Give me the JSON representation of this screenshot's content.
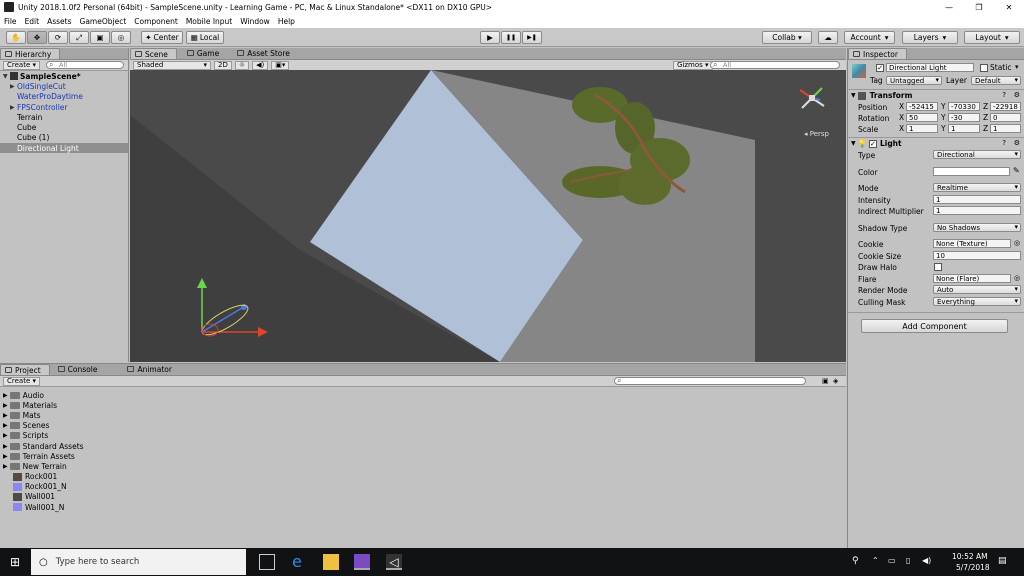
{
  "window": {
    "title": "Unity 2018.1.0f2 Personal (64bit) - SampleScene.unity - Learning Game - PC, Mac & Linux Standalone* <DX11 on DX10 GPU>",
    "min": "—",
    "max": "❐",
    "close": "✕"
  },
  "menu": [
    "File",
    "Edit",
    "Assets",
    "GameObject",
    "Component",
    "Mobile Input",
    "Window",
    "Help"
  ],
  "toolbar": {
    "center": "Center",
    "local": "Local",
    "collab": "Collab ▾",
    "account": "Account",
    "layers": "Layers",
    "layout": "Layout",
    "play": "▶",
    "pause": "❚❚",
    "step": "▶❚"
  },
  "hierarchy": {
    "tab": "Hierarchy",
    "create": "Create",
    "search_placeholder": "All",
    "scene": "SampleScene*",
    "items": [
      {
        "label": "OldSingleCut",
        "blue": true,
        "arrow": "▶"
      },
      {
        "label": "WaterProDaytime",
        "blue": true,
        "arrow": ""
      },
      {
        "label": "FPSController",
        "blue": true,
        "arrow": "▶"
      },
      {
        "label": "Terrain",
        "blue": false,
        "arrow": ""
      },
      {
        "label": "Cube",
        "blue": false,
        "arrow": ""
      },
      {
        "label": "Cube (1)",
        "blue": false,
        "arrow": ""
      },
      {
        "label": "Directional Light",
        "blue": false,
        "arrow": "",
        "selected": true
      }
    ]
  },
  "scene": {
    "tabs": [
      "Scene",
      "Game",
      "Asset Store"
    ],
    "shading": "Shaded",
    "mode2d": "2D",
    "gizmos": "Gizmos",
    "search_placeholder": "All",
    "persp": "◂ Persp"
  },
  "project": {
    "tabs": [
      "Project",
      "Console",
      "Animator"
    ],
    "create": "Create",
    "folders": [
      "Audio",
      "Materials",
      "Mats",
      "Scenes",
      "Scripts",
      "Standard Assets",
      "Terrain Assets",
      "New Terrain"
    ],
    "assets": [
      {
        "label": "Rock001",
        "color": "#5a4a3a"
      },
      {
        "label": "Rock001_N",
        "color": "#8a86f2"
      },
      {
        "label": "Wall001",
        "color": "#4e4a46"
      },
      {
        "label": "Wall001_N",
        "color": "#8a86f2"
      }
    ]
  },
  "inspector": {
    "tab": "Inspector",
    "object_name": "Directional Light",
    "static": "Static",
    "tag_label": "Tag",
    "tag_value": "Untagged",
    "layer_label": "Layer",
    "layer_value": "Default",
    "transform": {
      "title": "Transform",
      "position": {
        "label": "Position",
        "x": "-52415",
        "y": "-70330",
        "z": "-22918"
      },
      "rotation": {
        "label": "Rotation",
        "x": "50",
        "y": "-30",
        "z": "0"
      },
      "scale": {
        "label": "Scale",
        "x": "1",
        "y": "1",
        "z": "1"
      }
    },
    "light": {
      "title": "Light",
      "type_label": "Type",
      "type_value": "Directional",
      "color_label": "Color",
      "mode_label": "Mode",
      "mode_value": "Realtime",
      "intensity_label": "Intensity",
      "intensity_value": "1",
      "indirect_label": "Indirect Multiplier",
      "indirect_value": "1",
      "shadow_label": "Shadow Type",
      "shadow_value": "No Shadows",
      "cookie_label": "Cookie",
      "cookie_value": "None (Texture)",
      "cookie_size_label": "Cookie Size",
      "cookie_size_value": "10",
      "draw_halo_label": "Draw Halo",
      "flare_label": "Flare",
      "flare_value": "None (Flare)",
      "render_mode_label": "Render Mode",
      "render_mode_value": "Auto",
      "culling_label": "Culling Mask",
      "culling_value": "Everything"
    },
    "add_component": "Add Component"
  },
  "taskbar": {
    "search_placeholder": "Type here to search",
    "time": "10:52 AM",
    "date": "5/7/2018"
  },
  "colors": {
    "scene_bg": "#4a4a4a",
    "water_plane": "#b4c4dc",
    "terrain_plane": "#8a8a8a",
    "grass": "#5a6a2a",
    "selection": "#8f8f8f",
    "taskbar": "#101214"
  }
}
